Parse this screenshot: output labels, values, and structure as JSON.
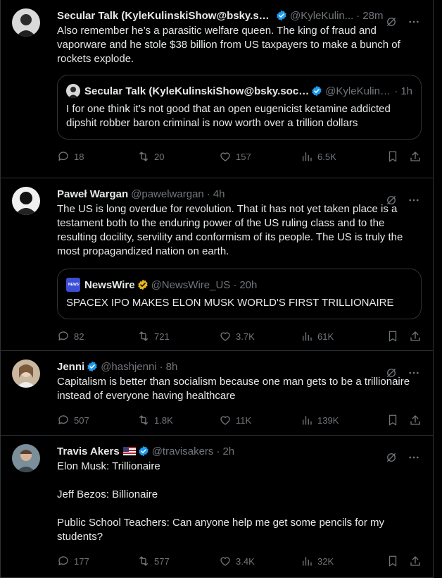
{
  "colors": {
    "background": "#000000",
    "text": "#e7e9ea",
    "muted": "#71767b",
    "border": "#2f3336",
    "verified_blue": "#1d9bf0",
    "verified_gold": "#e2b719"
  },
  "tweets": [
    {
      "name": "Secular Talk (KyleKulinskiShow@bsky.soci...",
      "verified": "blue",
      "handle": "@KyleKulin...",
      "time": "28m",
      "text": "Also remember he’s a parasitic welfare queen. The king of fraud and vaporware and he stole $38 billion from US taxpayers to make a bunch of rockets explode.",
      "quote": {
        "name": "Secular Talk (KyleKulinskiShow@bsky.social)",
        "verified": "blue",
        "handle": "@KyleKulinski",
        "time": "1h",
        "text": "I for one think it’s not good that an open eugenicist ketamine addicted dipshit robber baron criminal is now worth over a trillion dollars"
      },
      "stats": {
        "replies": "18",
        "retweets": "20",
        "likes": "157",
        "views": "6.5K"
      }
    },
    {
      "name": "Paweł Wargan",
      "verified": "none",
      "handle": "@pawelwargan",
      "time": "4h",
      "text": "The US is long overdue for revolution. That it has not yet taken place is a testament both to the enduring power of the US ruling class and to the resulting docility, servility and conformism of its people. The US is truly the most propagandized nation on earth.",
      "quote": {
        "name": "NewsWire",
        "verified": "gold",
        "handle": "@NewsWire_US",
        "time": "20h",
        "text": "SPACEX IPO MAKES ELON MUSK WORLD'S FIRST TRILLIONAIRE",
        "avatar_text": "NEWS WIRE"
      },
      "stats": {
        "replies": "82",
        "retweets": "721",
        "likes": "3.7K",
        "views": "61K"
      }
    },
    {
      "name": "Jenni",
      "verified": "blue",
      "handle": "@hashjenni",
      "time": "8h",
      "text": "Capitalism is better than socialism because one man gets to be a trillionaire instead of everyone having healthcare",
      "stats": {
        "replies": "507",
        "retweets": "1.8K",
        "likes": "11K",
        "views": "139K"
      }
    },
    {
      "name": "Travis Akers",
      "verified": "blue",
      "handle": "@travisakers",
      "time": "2h",
      "text": "Elon Musk: Trillionaire\n\nJeff Bezos: Billionaire\n\nPublic School Teachers: Can anyone help me get some pencils for my students?",
      "stats": {
        "replies": "177",
        "retweets": "577",
        "likes": "3.4K",
        "views": "32K"
      }
    }
  ],
  "separator": "·"
}
